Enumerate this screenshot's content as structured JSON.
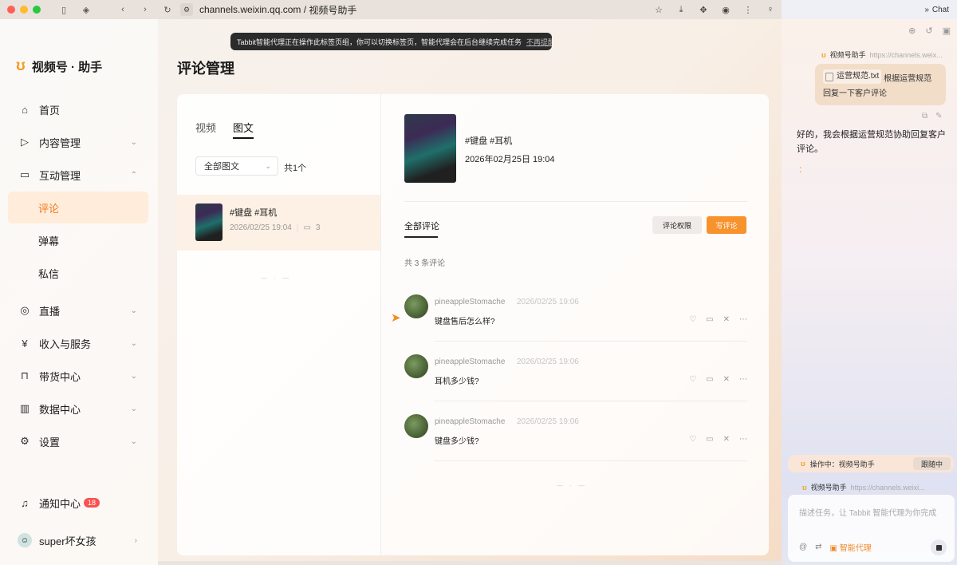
{
  "browser": {
    "url_host": "channels.weixin.qq.com",
    "url_sep": " / ",
    "url_title": "视频号助手",
    "chat_label": "Chat"
  },
  "colors": {
    "accent": "#f7922d",
    "brand_logo": "#f29d1f",
    "badge": "#fa5151"
  },
  "banner": {
    "text": "Tabbit智能代理正在操作此标签页组，你可以切换标签页，智能代理会在后台继续完成任务",
    "link": "不再提醒"
  },
  "sidebar": {
    "logo": "视频号 · 助手",
    "items": [
      {
        "label": "首页",
        "icon": "home-icon"
      },
      {
        "label": "内容管理",
        "icon": "content-icon"
      },
      {
        "label": "互动管理",
        "icon": "interaction-icon"
      },
      {
        "label": "评论"
      },
      {
        "label": "弹幕"
      },
      {
        "label": "私信"
      },
      {
        "label": "直播",
        "icon": "live-icon"
      },
      {
        "label": "收入与服务",
        "icon": "yen-icon"
      },
      {
        "label": "带货中心",
        "icon": "bag-icon"
      },
      {
        "label": "数据中心",
        "icon": "chart-icon"
      },
      {
        "label": "设置",
        "icon": "settings-icon"
      }
    ],
    "notify_label": "通知中心",
    "notify_count": "18",
    "user_name": "super坏女孩"
  },
  "page": {
    "title": "评论管理"
  },
  "left_panel": {
    "tabs": [
      "视频",
      "图文"
    ],
    "filter": "全部图文",
    "count": "共1个",
    "item": {
      "title": "#键盘 #耳机",
      "date": "2026/02/25 19:04",
      "comments": "3"
    }
  },
  "post": {
    "title": "#键盘 #耳机",
    "date": "2026年02月25日 19:04"
  },
  "comments_section": {
    "tab": "全部评论",
    "perm_button": "评论权限",
    "write_button": "写评论",
    "total": "共 3 条评论",
    "list": [
      {
        "user": "pineappleStomache",
        "time": "2026/02/25 19:06",
        "text": "键盘售后怎么样?"
      },
      {
        "user": "pineappleStomache",
        "time": "2026/02/25 19:06",
        "text": "耳机多少钱?"
      },
      {
        "user": "pineappleStomache",
        "time": "2026/02/25 19:06",
        "text": "键盘多少钱?"
      }
    ]
  },
  "chat": {
    "ref_name": "视频号助手",
    "ref_url": "https://channels.weix...",
    "user_file": "运营规范.txt",
    "user_msg": "根据运营规范回复一下客户评论",
    "reply": "好的，我会根据运营规范协助回复客户评论。",
    "typing": ":",
    "status": "操作中：视频号助手",
    "follow": "跟随中",
    "ref2_name": "视频号助手",
    "ref2_url": "https://channels.weixi...",
    "input_placeholder": "描述任务，让 Tabbit 智能代理为你完成",
    "agent_label": "智能代理"
  }
}
